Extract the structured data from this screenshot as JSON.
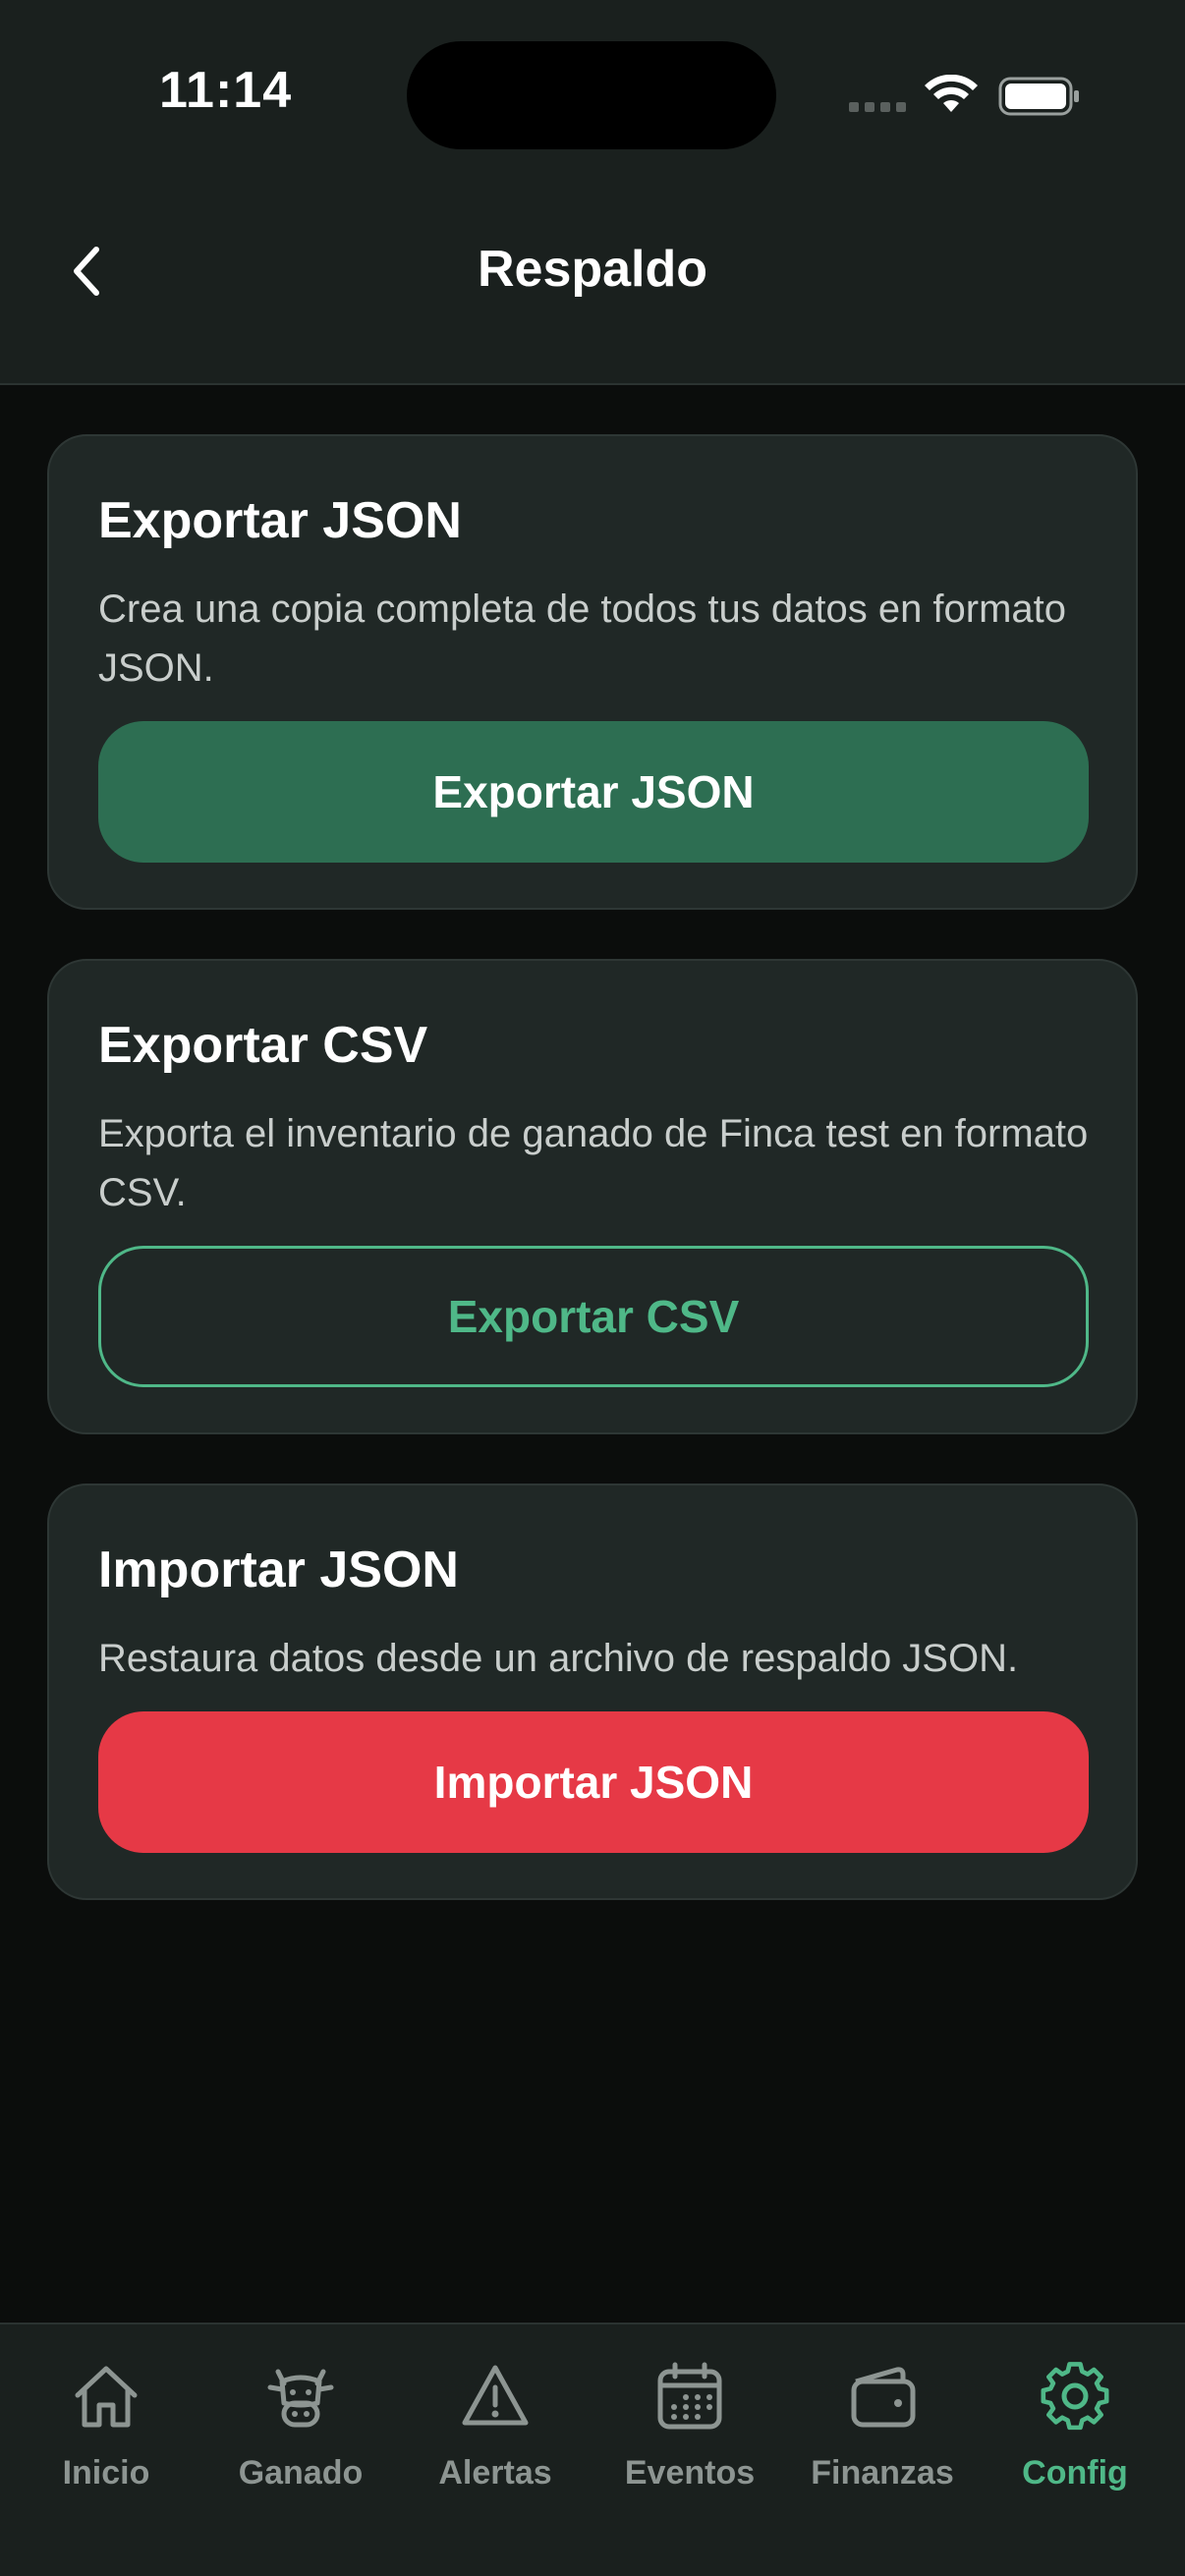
{
  "status_bar": {
    "time": "11:14"
  },
  "header": {
    "title": "Respaldo"
  },
  "cards": [
    {
      "title": "Exportar JSON",
      "description": "Crea una copia completa de todos tus datos en formato JSON.",
      "button_label": "Exportar JSON"
    },
    {
      "title": "Exportar CSV",
      "description": "Exporta el inventario de ganado de Finca test en formato CSV.",
      "button_label": "Exportar CSV"
    },
    {
      "title": "Importar JSON",
      "description": "Restaura datos desde un archivo de respaldo JSON.",
      "button_label": "Importar JSON"
    }
  ],
  "tabs": [
    {
      "label": "Inicio",
      "icon": "house-icon"
    },
    {
      "label": "Ganado",
      "icon": "cow-icon"
    },
    {
      "label": "Alertas",
      "icon": "warning-triangle-icon"
    },
    {
      "label": "Eventos",
      "icon": "calendar-icon"
    },
    {
      "label": "Finanzas",
      "icon": "wallet-icon"
    },
    {
      "label": "Config",
      "icon": "gear-icon",
      "active": true
    }
  ],
  "colors": {
    "accent": "#4fb888",
    "primary_button": "#2d6e52",
    "danger_button": "#e63946",
    "card_background": "#202826",
    "page_background": "#0b0d0c"
  }
}
